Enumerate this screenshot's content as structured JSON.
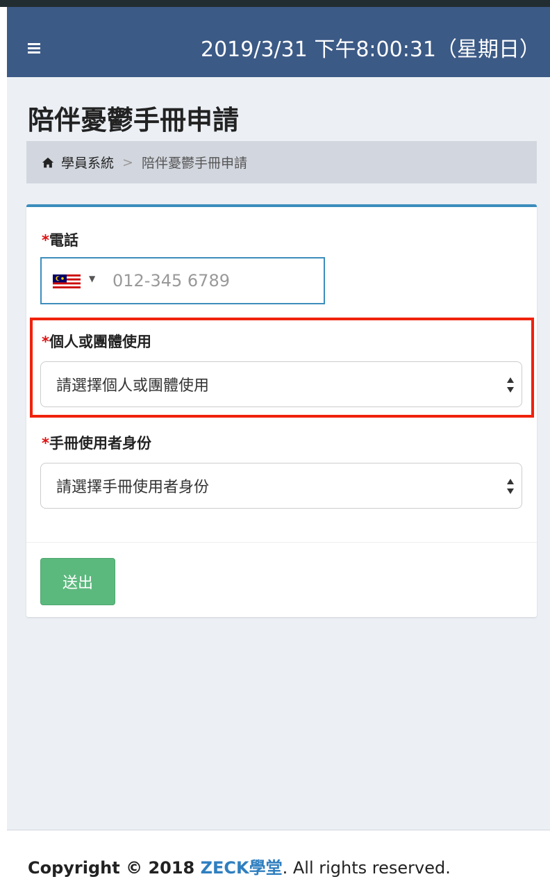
{
  "header": {
    "datetime": "2019/3/31 下午8:00:31（星期日）"
  },
  "page": {
    "title": "陪伴憂鬱手冊申請"
  },
  "breadcrumb": {
    "home_label": "學員系統",
    "separator": ">",
    "current": "陪伴憂鬱手冊申請"
  },
  "form": {
    "phone": {
      "required_mark": "*",
      "label": "電話",
      "placeholder": "012-345 6789",
      "country_flag": "malaysia-flag-icon"
    },
    "usage_type": {
      "required_mark": "*",
      "label": "個人或團體使用",
      "selected": "請選擇個人或團體使用"
    },
    "user_identity": {
      "required_mark": "*",
      "label": "手冊使用者身份",
      "selected": "請選擇手冊使用者身份"
    },
    "submit_label": "送出"
  },
  "footer": {
    "prefix": "Copyright © 2018 ",
    "brand": "ZECK學堂",
    "suffix": ". All rights reserved."
  },
  "colors": {
    "header_bg": "#3c5a86",
    "card_accent": "#3c8dbc",
    "submit_green": "#5cb97e",
    "highlight_red": "#f0220c",
    "brand_blue": "#2f7fc0"
  }
}
